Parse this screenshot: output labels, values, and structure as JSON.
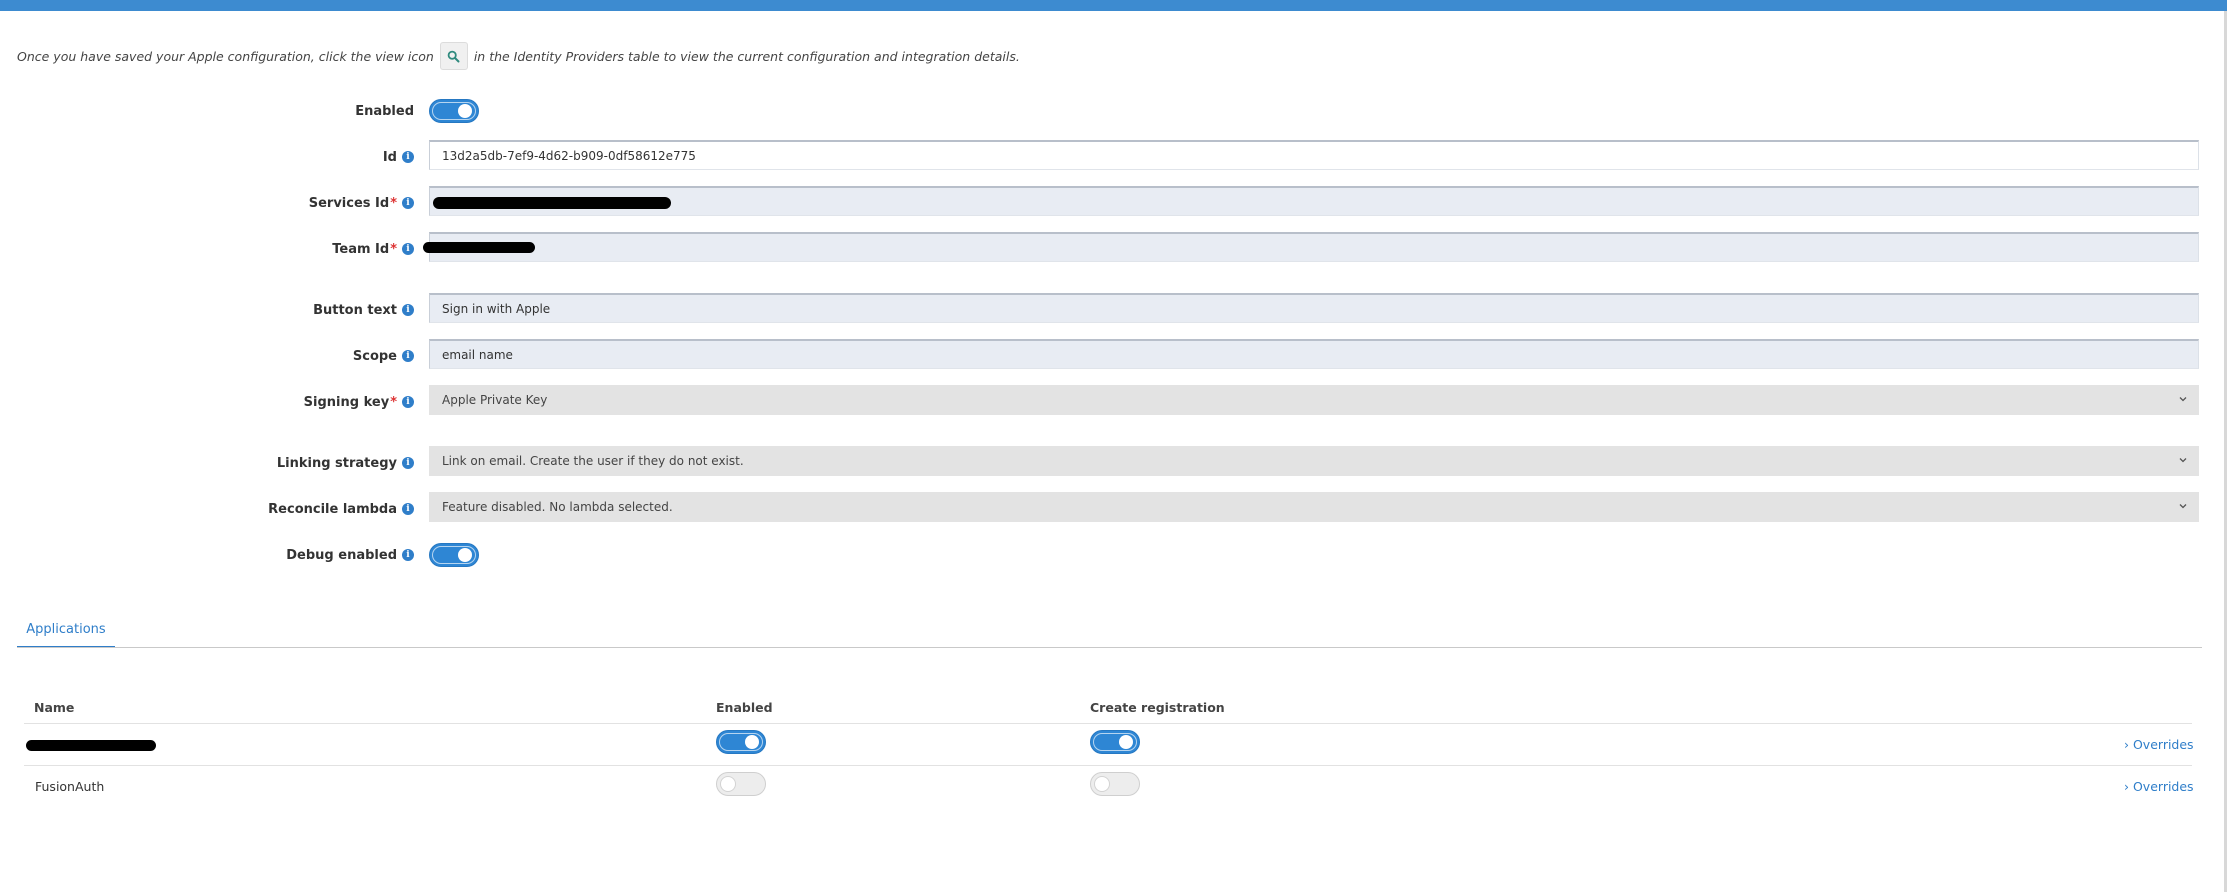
{
  "intro": {
    "before_icon": "Once you have saved your Apple configuration, click the view icon",
    "after_icon": "in the Identity Providers table to view the current configuration and integration details."
  },
  "form": {
    "enabled": {
      "label": "Enabled",
      "value": true
    },
    "id": {
      "label": "Id",
      "value": "13d2a5db-7ef9-4d62-b909-0df58612e775"
    },
    "services_id": {
      "label": "Services Id",
      "required": "*",
      "value": "[redacted]"
    },
    "team_id": {
      "label": "Team Id",
      "required": "*",
      "value": "[redacted]"
    },
    "button_text": {
      "label": "Button text",
      "value": "Sign in with Apple"
    },
    "scope": {
      "label": "Scope",
      "value": "email name"
    },
    "signing_key": {
      "label": "Signing key",
      "required": "*",
      "selected": "Apple Private Key"
    },
    "linking_strategy": {
      "label": "Linking strategy",
      "selected": "Link on email. Create the user if they do not exist."
    },
    "reconcile_lambda": {
      "label": "Reconcile lambda",
      "selected": "Feature disabled. No lambda selected."
    },
    "debug_enabled": {
      "label": "Debug enabled",
      "value": true
    }
  },
  "tabs": {
    "applications": "Applications"
  },
  "applications_table": {
    "headers": {
      "name": "Name",
      "enabled": "Enabled",
      "create_registration": "Create registration"
    },
    "rows": [
      {
        "name": "[redacted]",
        "enabled": true,
        "create_registration": true,
        "overrides": "› Overrides"
      },
      {
        "name": "FusionAuth",
        "enabled": false,
        "create_registration": false,
        "overrides": "› Overrides"
      }
    ]
  },
  "colors": {
    "accent": "#2e86d4",
    "top_bar": "#3d8bd0",
    "field_bg": "#e8ecf3",
    "select_bg": "#e3e3e3"
  }
}
